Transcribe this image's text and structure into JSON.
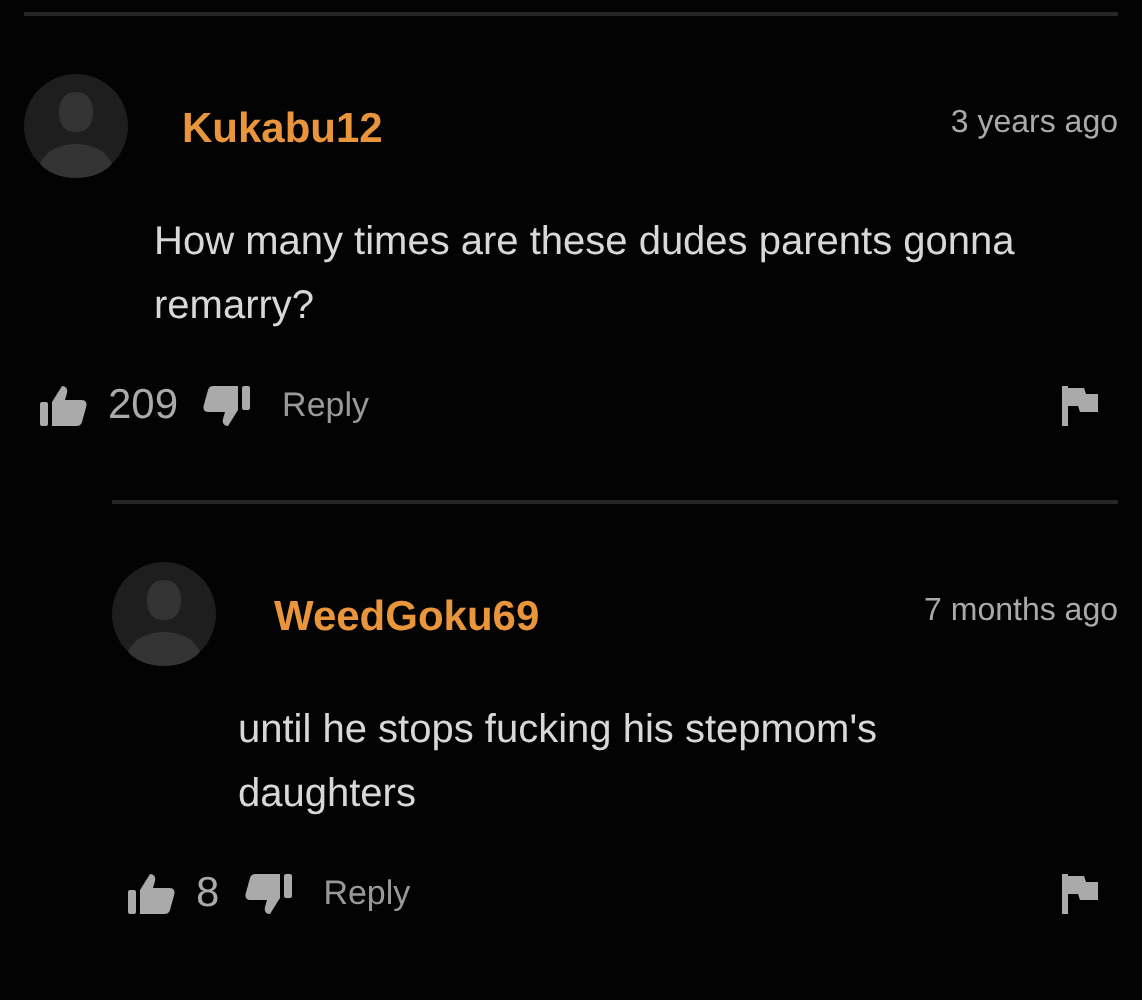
{
  "comments": [
    {
      "author": "Kukabu12",
      "time": "3 years ago",
      "text": "How many times are these dudes parents gonna remarry?",
      "likes": "209",
      "reply_label": "Reply",
      "replies": [
        {
          "author": "WeedGoku69",
          "time": "7 months ago",
          "text": "until he stops fucking his stepmom's daughters",
          "likes": "8",
          "reply_label": "Reply"
        }
      ]
    }
  ]
}
